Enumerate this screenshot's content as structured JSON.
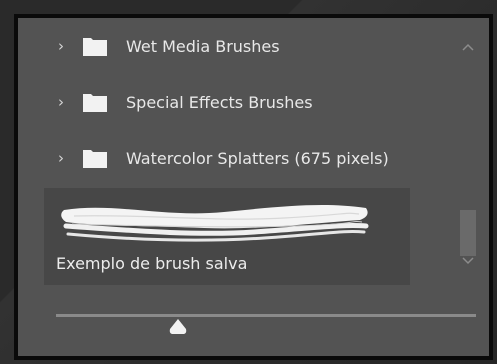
{
  "brush_groups": [
    {
      "label": "Wet Media Brushes",
      "icon": "folder-icon",
      "expand_icon": "chevron-right-icon"
    },
    {
      "label": "Special Effects Brushes",
      "icon": "folder-icon",
      "expand_icon": "chevron-right-icon"
    },
    {
      "label": "Watercolor Splatters (675 pixels)",
      "icon": "folder-icon",
      "expand_icon": "chevron-right-icon"
    }
  ],
  "preset": {
    "label": "Exemplo de brush salva",
    "selected": true
  },
  "chevron_glyph": "›",
  "scrollbar": {
    "up_icon": "chevron-up-icon",
    "down_icon": "chevron-down-icon"
  },
  "size_slider": {
    "icon": "slider-thumb-icon",
    "level": 0.29
  },
  "colors": {
    "panel_bg": "#535353",
    "preset_bg": "#474747",
    "text": "#e8e8e8",
    "border": "#0a0a0a"
  }
}
